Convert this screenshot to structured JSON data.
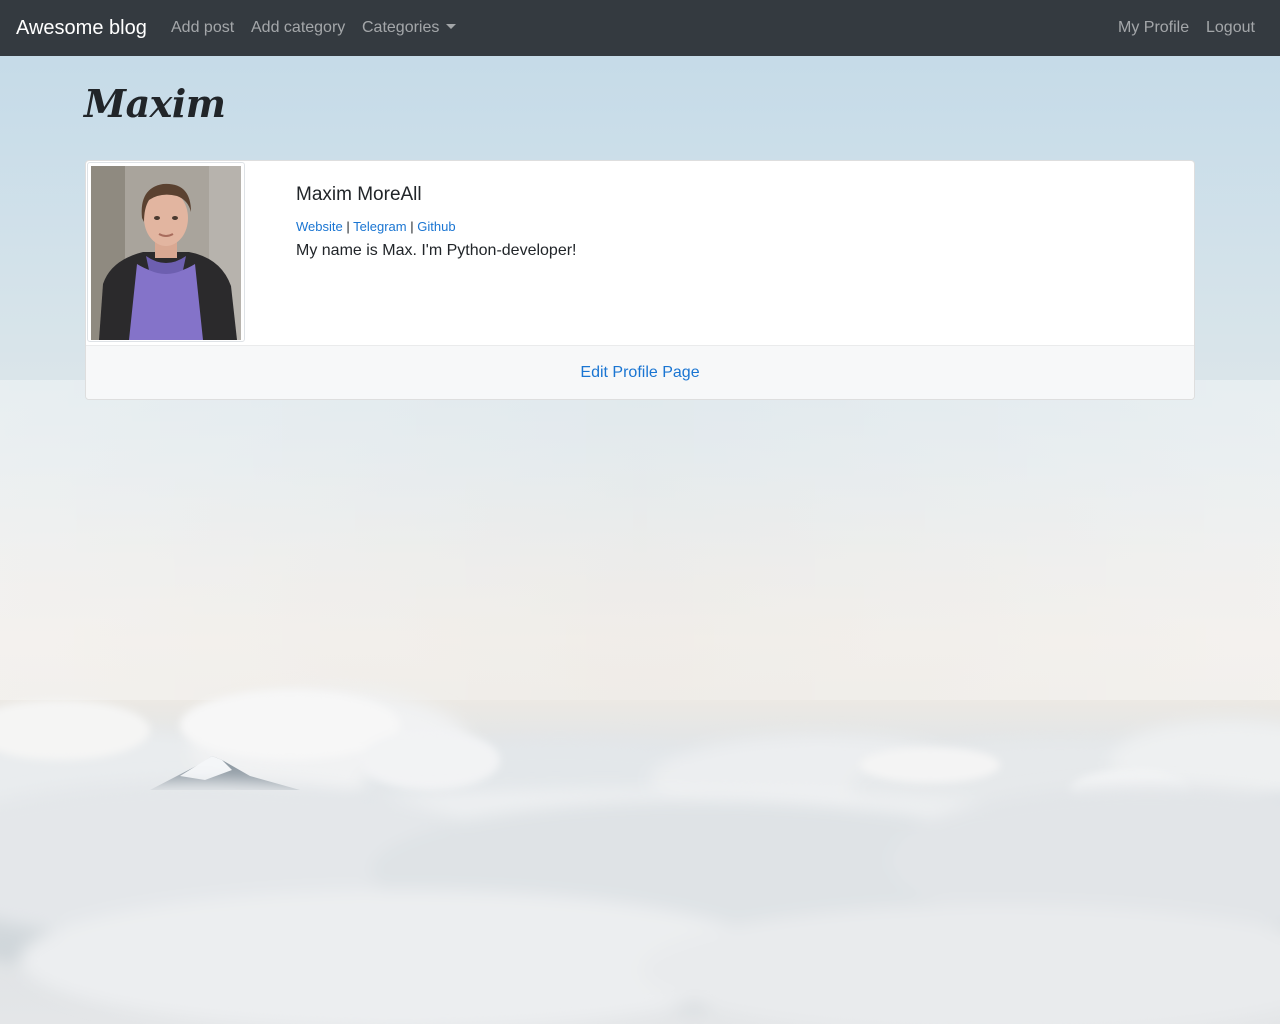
{
  "navbar": {
    "brand": "Awesome blog",
    "left_links": [
      {
        "label": "Add post"
      },
      {
        "label": "Add category"
      },
      {
        "label": "Categories"
      }
    ],
    "right_links": [
      {
        "label": "My Profile"
      },
      {
        "label": "Logout"
      }
    ]
  },
  "page": {
    "title": "Maxim"
  },
  "profile": {
    "name": "Maxim MoreAll",
    "links": [
      {
        "label": "Website"
      },
      {
        "label": "Telegram"
      },
      {
        "label": "Github"
      }
    ],
    "separator": "|",
    "bio": "My name is Max. I'm Python-developer!",
    "edit_label": "Edit Profile Page"
  },
  "colors": {
    "navbar_bg": "#343a40",
    "link": "#1a75d2",
    "text": "#212529"
  },
  "icons": {
    "dropdown": "caret-down-icon"
  }
}
